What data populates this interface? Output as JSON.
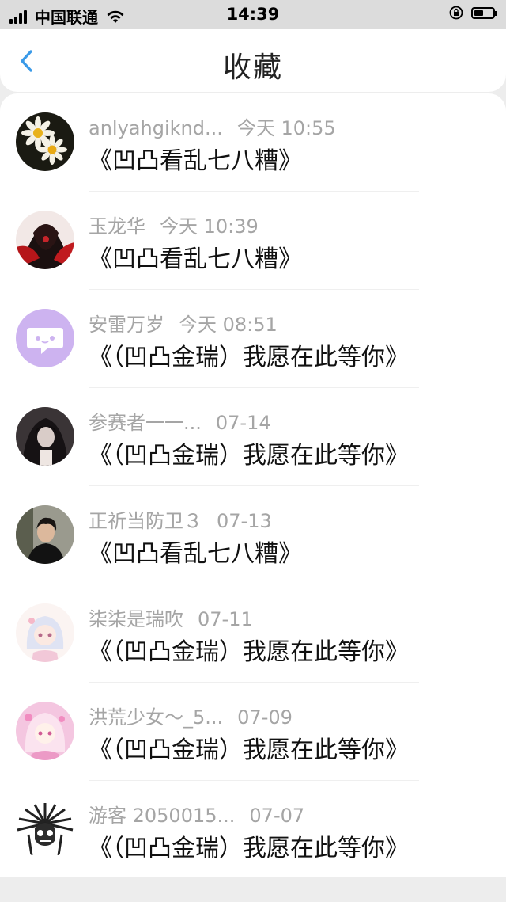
{
  "status_bar": {
    "carrier": "中国联通",
    "time": "14:39",
    "battery_level": 0.5
  },
  "nav": {
    "title": "收藏"
  },
  "items": [
    {
      "name": "anlyahgiknd...",
      "time": "今天 10:55",
      "content": "《凹凸看乱七八糟》",
      "avatar": "daisy-flowers-avatar"
    },
    {
      "name": "玉龙华",
      "time": "今天 10:39",
      "content": "《凹凸看乱七八糟》",
      "avatar": "red-anime-avatar"
    },
    {
      "name": "安雷万岁",
      "time": "今天 08:51",
      "content": "《（凹凸金瑞）我愿在此等你》",
      "avatar": "chat-bubble-avatar"
    },
    {
      "name": "参赛者一一...",
      "time": "07-14",
      "content": "《（凹凸金瑞）我愿在此等你》",
      "avatar": "dark-anime-avatar"
    },
    {
      "name": "正祈当防卫３",
      "time": "07-13",
      "content": "《凹凸看乱七八糟》",
      "avatar": "photo-person-avatar"
    },
    {
      "name": "柒柒是瑞吹",
      "time": "07-11",
      "content": "《（凹凸金瑞）我愿在此等你》",
      "avatar": "chibi-anime-avatar"
    },
    {
      "name": "洪荒少女～_5...",
      "time": "07-09",
      "content": "《（凹凸金瑞）我愿在此等你》",
      "avatar": "pink-anime-avatar"
    },
    {
      "name": "游客 2050015...",
      "time": "07-07",
      "content": "《（凹凸金瑞）我愿在此等你》",
      "avatar": "skull-headdress-avatar"
    }
  ],
  "colors": {
    "accent": "#3a9ae8",
    "meta_text": "#a5a5a5"
  }
}
